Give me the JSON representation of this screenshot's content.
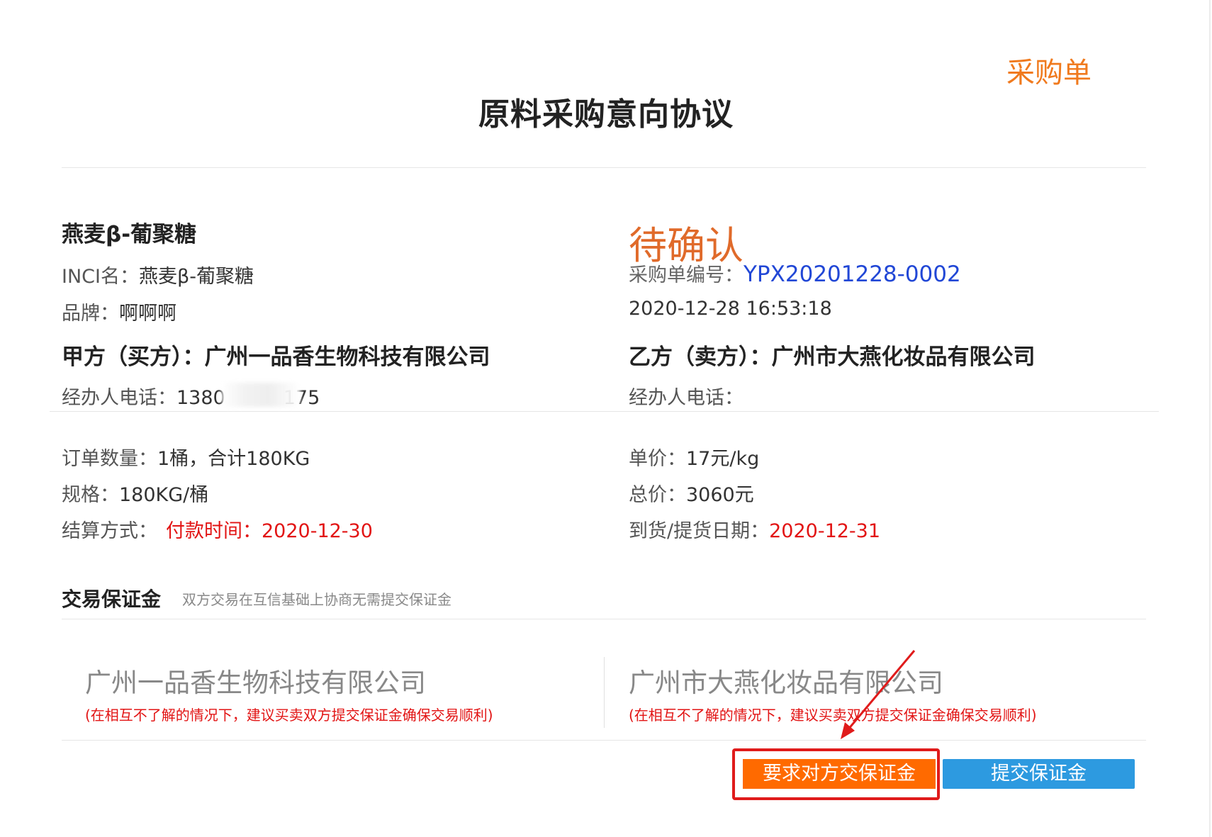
{
  "header": {
    "corner_label": "采购单",
    "title": "原料采购意向协议"
  },
  "product": {
    "name": "燕麦β-葡聚糖",
    "inci_label": "INCI名：",
    "inci_value": "燕麦β-葡聚糖",
    "brand_label": "品牌：",
    "brand_value": "啊啊啊"
  },
  "order": {
    "status": "待确认",
    "number_label": "采购单编号：",
    "number": "YPX20201228-0002",
    "datetime": "2020-12-28 16:53:18"
  },
  "party_a": {
    "label": "甲方（买方）：",
    "company": "广州一品香生物科技有限公司",
    "phone_label": "经办人电话：",
    "phone_value": "1380",
    "phone_tail": "175"
  },
  "party_b": {
    "label": "乙方（卖方）：",
    "company": "广州市大燕化妆品有限公司",
    "phone_label": "经办人电话："
  },
  "details": {
    "quantity_label": "订单数量：",
    "quantity_value": "1桶，合计180KG",
    "spec_label": "规格：",
    "spec_value": "180KG/桶",
    "settle_label": "结算方式：",
    "settle_value": "付款时间：2020-12-30",
    "unit_price_label": "单价：",
    "unit_price_value": "17元/kg",
    "total_label": "总价：",
    "total_value": "3060元",
    "delivery_label": "到货/提货日期：",
    "delivery_value": "2020-12-31"
  },
  "deposit": {
    "title": "交易保证金",
    "note": "双方交易在互信基础上协商无需提交保证金",
    "left_company": "广州一品香生物科技有限公司",
    "right_company": "广州市大燕化妆品有限公司",
    "tip": "(在相互不了解的情况下，建议买卖双方提交保证金确保交易顺利)"
  },
  "actions": {
    "request_label": "要求对方交保证金",
    "submit_label": "提交保证金"
  },
  "colors": {
    "accent_orange": "#ff6a00",
    "button_blue": "#2d9ae0",
    "status_orange": "#e06a2a",
    "link_blue": "#2147d6",
    "warning_red": "#e21414"
  }
}
